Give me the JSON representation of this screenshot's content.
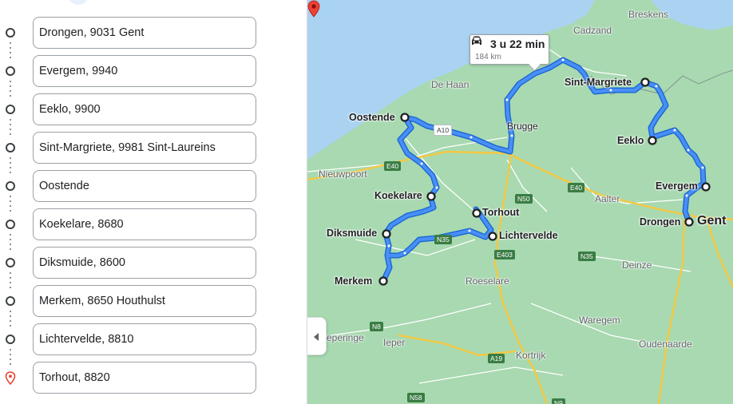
{
  "directions": {
    "waypoints": [
      {
        "value": "Drongen, 9031 Gent",
        "icon": "waypoint-circle-icon"
      },
      {
        "value": "Evergem, 9940",
        "icon": "waypoint-circle-icon"
      },
      {
        "value": "Eeklo, 9900",
        "icon": "waypoint-circle-icon"
      },
      {
        "value": "Sint-Margriete, 9981 Sint-Laureins",
        "icon": "waypoint-circle-icon"
      },
      {
        "value": "Oostende",
        "icon": "waypoint-circle-icon"
      },
      {
        "value": "Koekelare, 8680",
        "icon": "waypoint-circle-icon"
      },
      {
        "value": "Diksmuide, 8600",
        "icon": "waypoint-circle-icon"
      },
      {
        "value": "Merkem, 8650 Houthulst",
        "icon": "waypoint-circle-icon"
      },
      {
        "value": "Lichtervelde, 8810",
        "icon": "waypoint-circle-icon"
      },
      {
        "value": "Torhout, 8820",
        "icon": "destination-pin-icon"
      }
    ]
  },
  "map": {
    "route_info": {
      "duration": "3 u 22 min",
      "distance": "184 km",
      "icon": "car-icon"
    },
    "stops": [
      "Oostende",
      "Sint-Margriete",
      "Eeklo",
      "Evergem",
      "Koekelare",
      "Torhout",
      "Lichtervelde",
      "Drongen",
      "Diksmuide",
      "Merkem"
    ],
    "places": [
      "Breskens",
      "Cadzand",
      "De Haan",
      "Brugge",
      "Nieuwpoort",
      "Aalter",
      "Gent",
      "Roeselare",
      "Deinze",
      "Waregem",
      "Ieper",
      "Oudenaarde",
      "Kortrijk",
      "eperinge"
    ],
    "road_refs": [
      "A10",
      "E40",
      "N50",
      "E40",
      "N35",
      "E403",
      "N35",
      "N8",
      "A19",
      "N58",
      "N9"
    ],
    "colors": {
      "route": "#4a8ff7",
      "route_casing": "#1967d2",
      "land": "#a8d9b0",
      "sea": "#aad3f2",
      "motorway": "#f5c842",
      "destination_pin": "#ea4335"
    }
  }
}
